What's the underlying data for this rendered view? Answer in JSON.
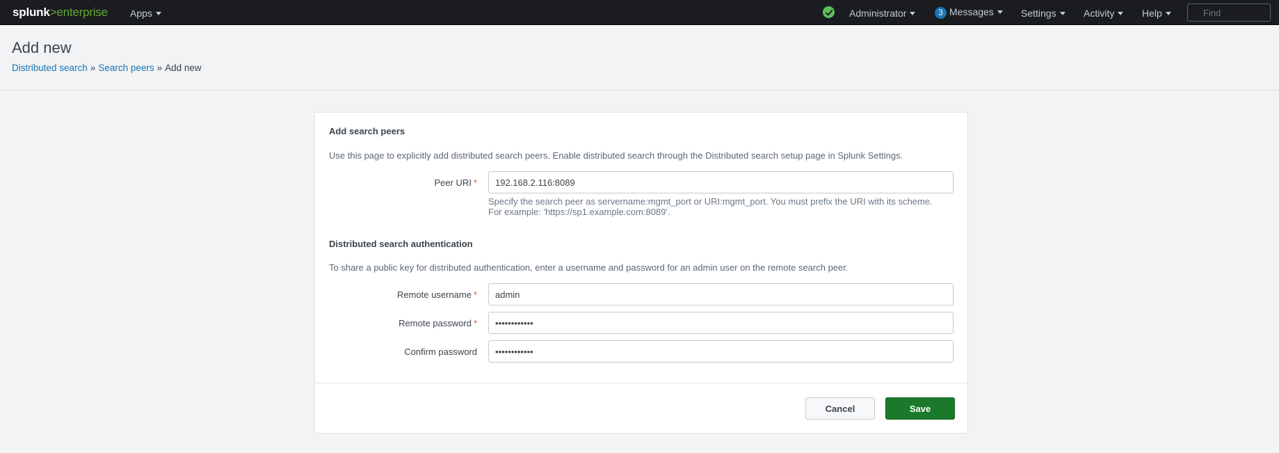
{
  "topbar": {
    "logo_part1": "splunk",
    "logo_part2": ">",
    "logo_part3": "enterprise",
    "apps_label": "Apps",
    "user_label": "Administrator",
    "messages_count": "3",
    "messages_label": "Messages",
    "settings_label": "Settings",
    "activity_label": "Activity",
    "help_label": "Help",
    "find_placeholder": "Find"
  },
  "header": {
    "title": "Add new",
    "breadcrumb": [
      "Distributed search",
      "Search peers",
      "Add new"
    ],
    "breadcrumb_sep": "»"
  },
  "form": {
    "section1_title": "Add search peers",
    "section1_desc": "Use this page to explicitly add distributed search peers. Enable distributed search through the Distributed search setup page in Splunk Settings.",
    "peer_uri_label": "Peer URI",
    "peer_uri_value": "192.168.2.116:8089",
    "peer_uri_help": "Specify the search peer as servername:mgmt_port or URI:mgmt_port. You must prefix the URI with its scheme. For example: 'https://sp1.example.com:8089'.",
    "section2_title": "Distributed search authentication",
    "section2_desc": "To share a public key for distributed authentication, enter a username and password for an admin user on the remote search peer.",
    "username_label": "Remote username",
    "username_value": "admin",
    "password_label": "Remote password",
    "password_value": "••••••••••••",
    "confirm_label": "Confirm password",
    "confirm_value": "••••••••••••",
    "required_mark": "*",
    "cancel_label": "Cancel",
    "save_label": "Save"
  },
  "colors": {
    "topbar_bg": "#1a1c20",
    "accent_green": "#65a637",
    "link_blue": "#1a73b6",
    "save_green": "#1a7a2a",
    "required_red": "#d6563c"
  }
}
